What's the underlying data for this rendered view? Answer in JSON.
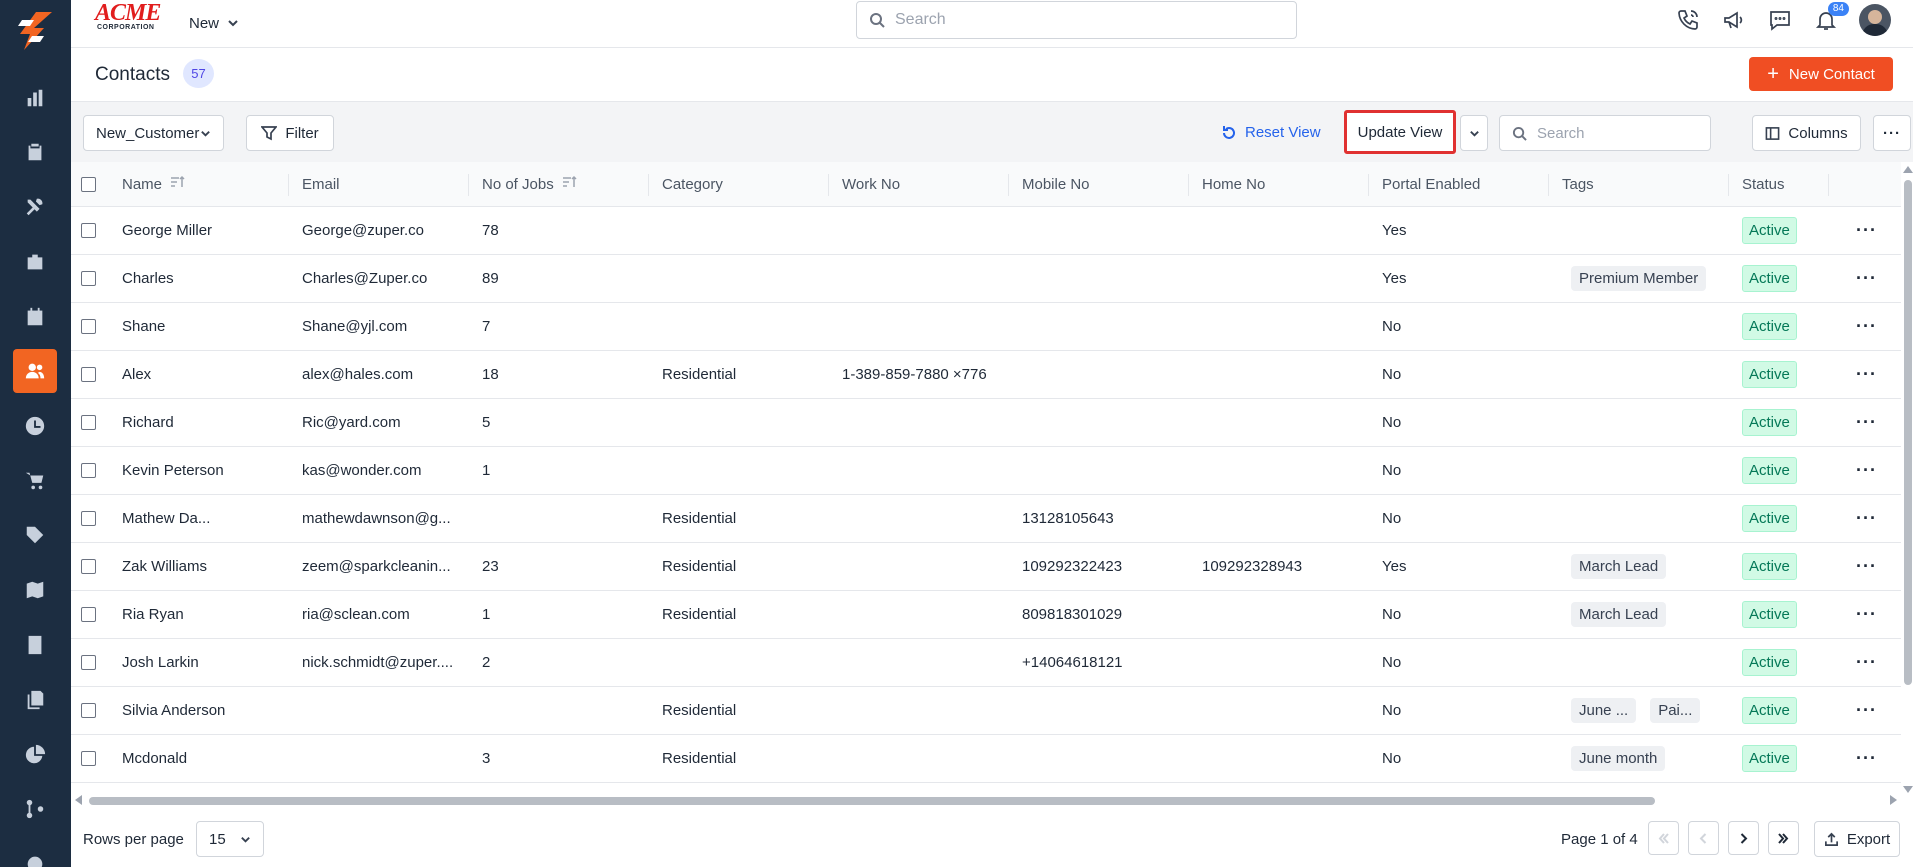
{
  "brand": {
    "name": "ACME",
    "sub": "CORPORATION"
  },
  "topbar": {
    "new_label": "New",
    "search_placeholder": "Search",
    "notification_count": "84"
  },
  "page": {
    "title": "Contacts",
    "count": "57",
    "new_button": "New Contact"
  },
  "toolbar": {
    "view_name": "New_Customer",
    "filter_label": "Filter",
    "reset_label": "Reset View",
    "update_label": "Update View",
    "search_placeholder": "Search",
    "columns_label": "Columns",
    "more_label": "···"
  },
  "table": {
    "headers": [
      "Name",
      "Email",
      "No of Jobs",
      "Category",
      "Work No",
      "Mobile No",
      "Home No",
      "Portal Enabled",
      "Tags",
      "Status"
    ],
    "rows": [
      {
        "name": "George Miller",
        "email": "George@zuper.co",
        "jobs": "78",
        "category": "",
        "work": "",
        "mobile": "",
        "home": "",
        "portal": "Yes",
        "tags": [],
        "status": "Active"
      },
      {
        "name": "Charles",
        "email": "Charles@Zuper.co",
        "jobs": "89",
        "category": "",
        "work": "",
        "mobile": "",
        "home": "",
        "portal": "Yes",
        "tags": [
          "Premium Member"
        ],
        "status": "Active"
      },
      {
        "name": "Shane",
        "email": "Shane@yjl.com",
        "jobs": "7",
        "category": "",
        "work": "",
        "mobile": "",
        "home": "",
        "portal": "No",
        "tags": [],
        "status": "Active"
      },
      {
        "name": "Alex",
        "email": "alex@hales.com",
        "jobs": "18",
        "category": "Residential",
        "work": "1-389-859-7880 ×776",
        "mobile": "",
        "home": "",
        "portal": "No",
        "tags": [],
        "status": "Active"
      },
      {
        "name": "Richard",
        "email": "Ric@yard.com",
        "jobs": "5",
        "category": "",
        "work": "",
        "mobile": "",
        "home": "",
        "portal": "No",
        "tags": [],
        "status": "Active"
      },
      {
        "name": "Kevin Peterson",
        "email": "kas@wonder.com",
        "jobs": "1",
        "category": "",
        "work": "",
        "mobile": "",
        "home": "",
        "portal": "No",
        "tags": [],
        "status": "Active"
      },
      {
        "name": "Mathew Da...",
        "email": "mathewdawnson@g...",
        "jobs": "",
        "category": "Residential",
        "work": "",
        "mobile": "13128105643",
        "home": "",
        "portal": "No",
        "tags": [],
        "status": "Active"
      },
      {
        "name": "Zak Williams",
        "email": "zeem@sparkcleanin...",
        "jobs": "23",
        "category": "Residential",
        "work": "",
        "mobile": "109292322423",
        "home": "109292328943",
        "portal": "Yes",
        "tags": [
          "March Lead"
        ],
        "status": "Active"
      },
      {
        "name": "Ria Ryan",
        "email": "ria@sclean.com",
        "jobs": "1",
        "category": "Residential",
        "work": "",
        "mobile": "809818301029",
        "home": "",
        "portal": "No",
        "tags": [
          "March Lead"
        ],
        "status": "Active"
      },
      {
        "name": "Josh Larkin",
        "email": "nick.schmidt@zuper....",
        "jobs": "2",
        "category": "",
        "work": "",
        "mobile": "+14064618121",
        "home": "",
        "portal": "No",
        "tags": [],
        "status": "Active"
      },
      {
        "name": "Silvia Anderson",
        "email": "",
        "jobs": "",
        "category": "Residential",
        "work": "",
        "mobile": "",
        "home": "",
        "portal": "No",
        "tags": [
          "June ...",
          "Pai..."
        ],
        "status": "Active"
      },
      {
        "name": "Mcdonald",
        "email": "",
        "jobs": "3",
        "category": "Residential",
        "work": "",
        "mobile": "",
        "home": "",
        "portal": "No",
        "tags": [
          "June month"
        ],
        "status": "Active"
      }
    ]
  },
  "footer": {
    "rows_per_page_label": "Rows per page",
    "rows_per_page": "15",
    "page_info": "Page 1 of 4",
    "export_label": "Export"
  },
  "colors": {
    "accent": "#f04e23",
    "nav_bg": "#1c2d41",
    "status_bg": "#d1fae5",
    "status_text": "#047857",
    "highlight": "#e03131"
  }
}
